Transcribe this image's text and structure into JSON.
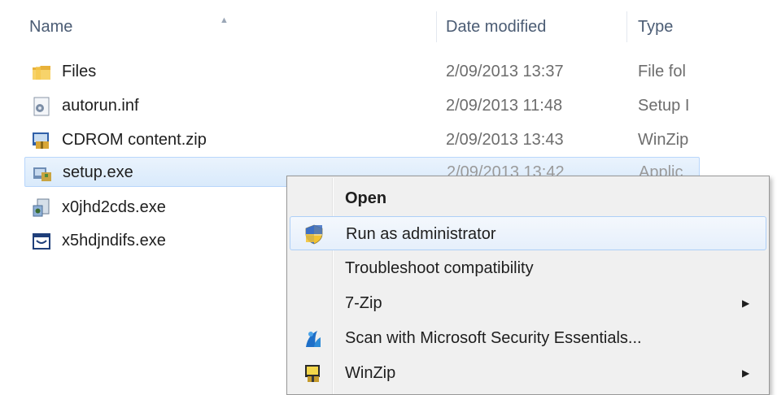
{
  "header": {
    "name_label": "Name",
    "date_label": "Date modified",
    "type_label": "Type"
  },
  "files": [
    {
      "name": "Files",
      "date": "2/09/2013 13:37",
      "type": "File fol",
      "icon": "folder-icon"
    },
    {
      "name": "autorun.inf",
      "date": "2/09/2013 11:48",
      "type": "Setup I",
      "icon": "setup-info-file-icon"
    },
    {
      "name": "CDROM content.zip",
      "date": "2/09/2013 13:43",
      "type": "WinZip",
      "icon": "winzip-file-icon"
    },
    {
      "name": "setup.exe",
      "date": "2/09/2013 13:42",
      "type": "Applic",
      "icon": "setup-exe-icon",
      "selected": true
    },
    {
      "name": "x0jhd2cds.exe",
      "date": "",
      "type": "",
      "icon": "exe-icon"
    },
    {
      "name": "x5hdjndifs.exe",
      "date": "",
      "type": "",
      "icon": "exe-window-icon"
    }
  ],
  "context_menu": {
    "items": [
      {
        "label": "Open",
        "bold": true,
        "icon": "",
        "submenu": false
      },
      {
        "label": "Run as administrator",
        "icon": "uac-shield-icon",
        "submenu": false,
        "hover": true
      },
      {
        "label": "Troubleshoot compatibility",
        "icon": "",
        "submenu": false
      },
      {
        "label": "7-Zip",
        "icon": "",
        "submenu": true
      },
      {
        "label": "Scan with Microsoft Security Essentials...",
        "icon": "security-essentials-icon",
        "submenu": false
      },
      {
        "label": "WinZip",
        "icon": "winzip-icon",
        "submenu": true
      }
    ]
  },
  "colors": {
    "selection_bg": "#d9eafb",
    "selection_border": "#b8d6fb",
    "menu_bg": "#f0f0f0",
    "header_text": "#4b5c74"
  }
}
